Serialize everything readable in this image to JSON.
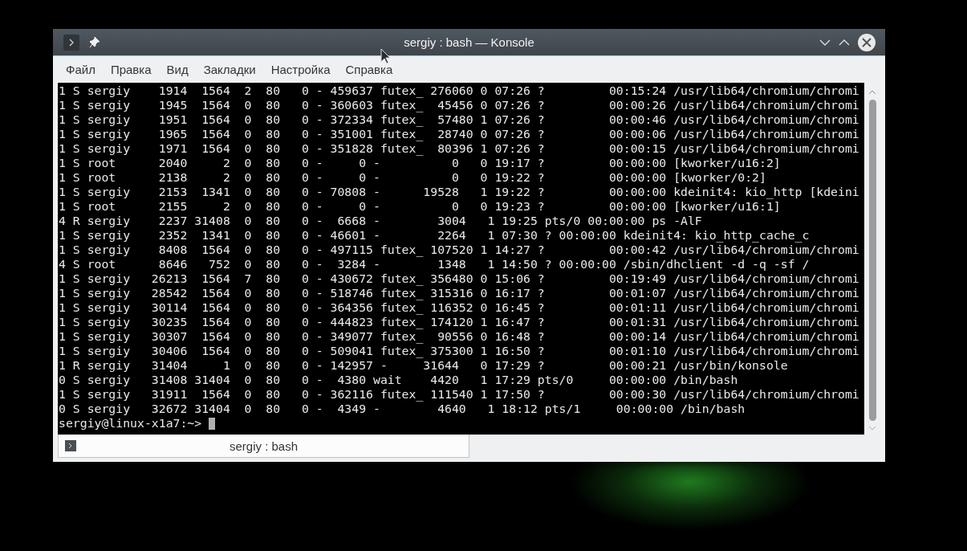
{
  "window": {
    "title": "sergiy : bash — Konsole"
  },
  "menu": [
    "Файл",
    "Правка",
    "Вид",
    "Закладки",
    "Настройка",
    "Справка"
  ],
  "terminal": {
    "lines": [
      "1 S sergiy    1914  1564  2  80   0 - 459637 futex_ 276060 0 07:26 ?         00:15:24 /usr/lib64/chromium/chromi",
      "1 S sergiy    1945  1564  0  80   0 - 360603 futex_  45456 0 07:26 ?         00:00:26 /usr/lib64/chromium/chromi",
      "1 S sergiy    1951  1564  0  80   0 - 372334 futex_  57480 1 07:26 ?         00:00:46 /usr/lib64/chromium/chromi",
      "1 S sergiy    1965  1564  0  80   0 - 351001 futex_  28740 0 07:26 ?         00:00:06 /usr/lib64/chromium/chromi",
      "1 S sergiy    1971  1564  0  80   0 - 351828 futex_  80396 1 07:26 ?         00:00:15 /usr/lib64/chromium/chromi",
      "1 S root      2040     2  0  80   0 -     0 -          0   0 19:17 ?         00:00:00 [kworker/u16:2]",
      "1 S root      2138     2  0  80   0 -     0 -          0   0 19:22 ?         00:00:00 [kworker/0:2]",
      "1 S sergiy    2153  1341  0  80   0 - 70808 -      19528   1 19:22 ?         00:00:00 kdeinit4: kio_http [kdeini",
      "1 S root      2155     2  0  80   0 -     0 -          0   0 19:23 ?         00:00:00 [kworker/u16:1]",
      "4 R sergiy    2237 31408  0  80   0 -  6668 -        3004   1 19:25 pts/0 00:00:00 ps -AlF",
      "1 S sergiy    2352  1341  0  80   0 - 46601 -        2264   1 07:30 ? 00:00:00 kdeinit4: kio_http_cache_c",
      "1 S sergiy    8408  1564  0  80   0 - 497115 futex_ 107520 1 14:27 ?         00:00:42 /usr/lib64/chromium/chromi",
      "4 S root      8646   752  0  80   0 -  3284 -        1348   1 14:50 ? 00:00:00 /sbin/dhclient -d -q -sf /",
      "1 S sergiy   26213  1564  7  80   0 - 430672 futex_ 356480 0 15:06 ?         00:19:49 /usr/lib64/chromium/chromi",
      "1 S sergiy   28542  1564  0  80   0 - 518746 futex_ 315316 0 16:17 ?         00:01:07 /usr/lib64/chromium/chromi",
      "1 S sergiy   30114  1564  0  80   0 - 364356 futex_ 116352 0 16:45 ?         00:01:11 /usr/lib64/chromium/chromi",
      "1 S sergiy   30235  1564  0  80   0 - 444823 futex_ 174120 1 16:47 ?         00:01:31 /usr/lib64/chromium/chromi",
      "1 S sergiy   30307  1564  0  80   0 - 349077 futex_  90556 0 16:48 ?         00:00:14 /usr/lib64/chromium/chromi",
      "1 S sergiy   30406  1564  0  80   0 - 509041 futex_ 375300 1 16:50 ?         00:01:10 /usr/lib64/chromium/chromi",
      "1 R sergiy   31404     1  0  80   0 - 142957 -     31644   0 17:29 ?         00:00:21 /usr/bin/konsole",
      "0 S sergiy   31408 31404  0  80   0 -  4380 wait    4420   1 17:29 pts/0     00:00:00 /bin/bash",
      "1 S sergiy   31911  1564  0  80   0 - 362116 futex_ 111540 1 17:50 ?         00:00:30 /usr/lib64/chromium/chromi",
      "0 S sergiy   32672 31404  0  80   0 -  4349 -        4640   1 18:12 pts/1     00:00:00 /bin/bash"
    ],
    "prompt": "sergiy@linux-x1a7:~>"
  },
  "tabs": [
    {
      "label": "sergiy : bash",
      "selected": true
    }
  ]
}
